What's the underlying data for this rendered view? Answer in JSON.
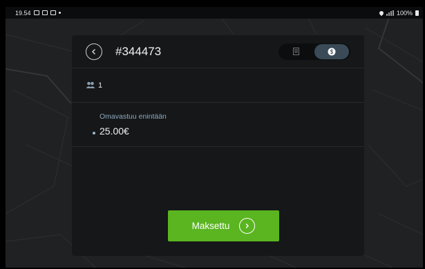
{
  "status_bar": {
    "time": "19.54",
    "battery": "100%"
  },
  "header": {
    "order_number": "#344473",
    "back_icon": "chevron-left-icon",
    "view_toggle": [
      {
        "icon": "receipt-icon",
        "active": false
      },
      {
        "icon": "coin-icon",
        "active": true
      }
    ]
  },
  "passengers": {
    "icon": "people-icon",
    "count": "1"
  },
  "deductible": {
    "label": "Omavastuu enintään",
    "value": "25.00€"
  },
  "pay_button": {
    "label": "Maksettu",
    "icon": "chevron-right-circle-icon"
  },
  "colors": {
    "accent_green": "#5ab520",
    "panel": "#151718",
    "label_blue": "#8fa9bf"
  }
}
